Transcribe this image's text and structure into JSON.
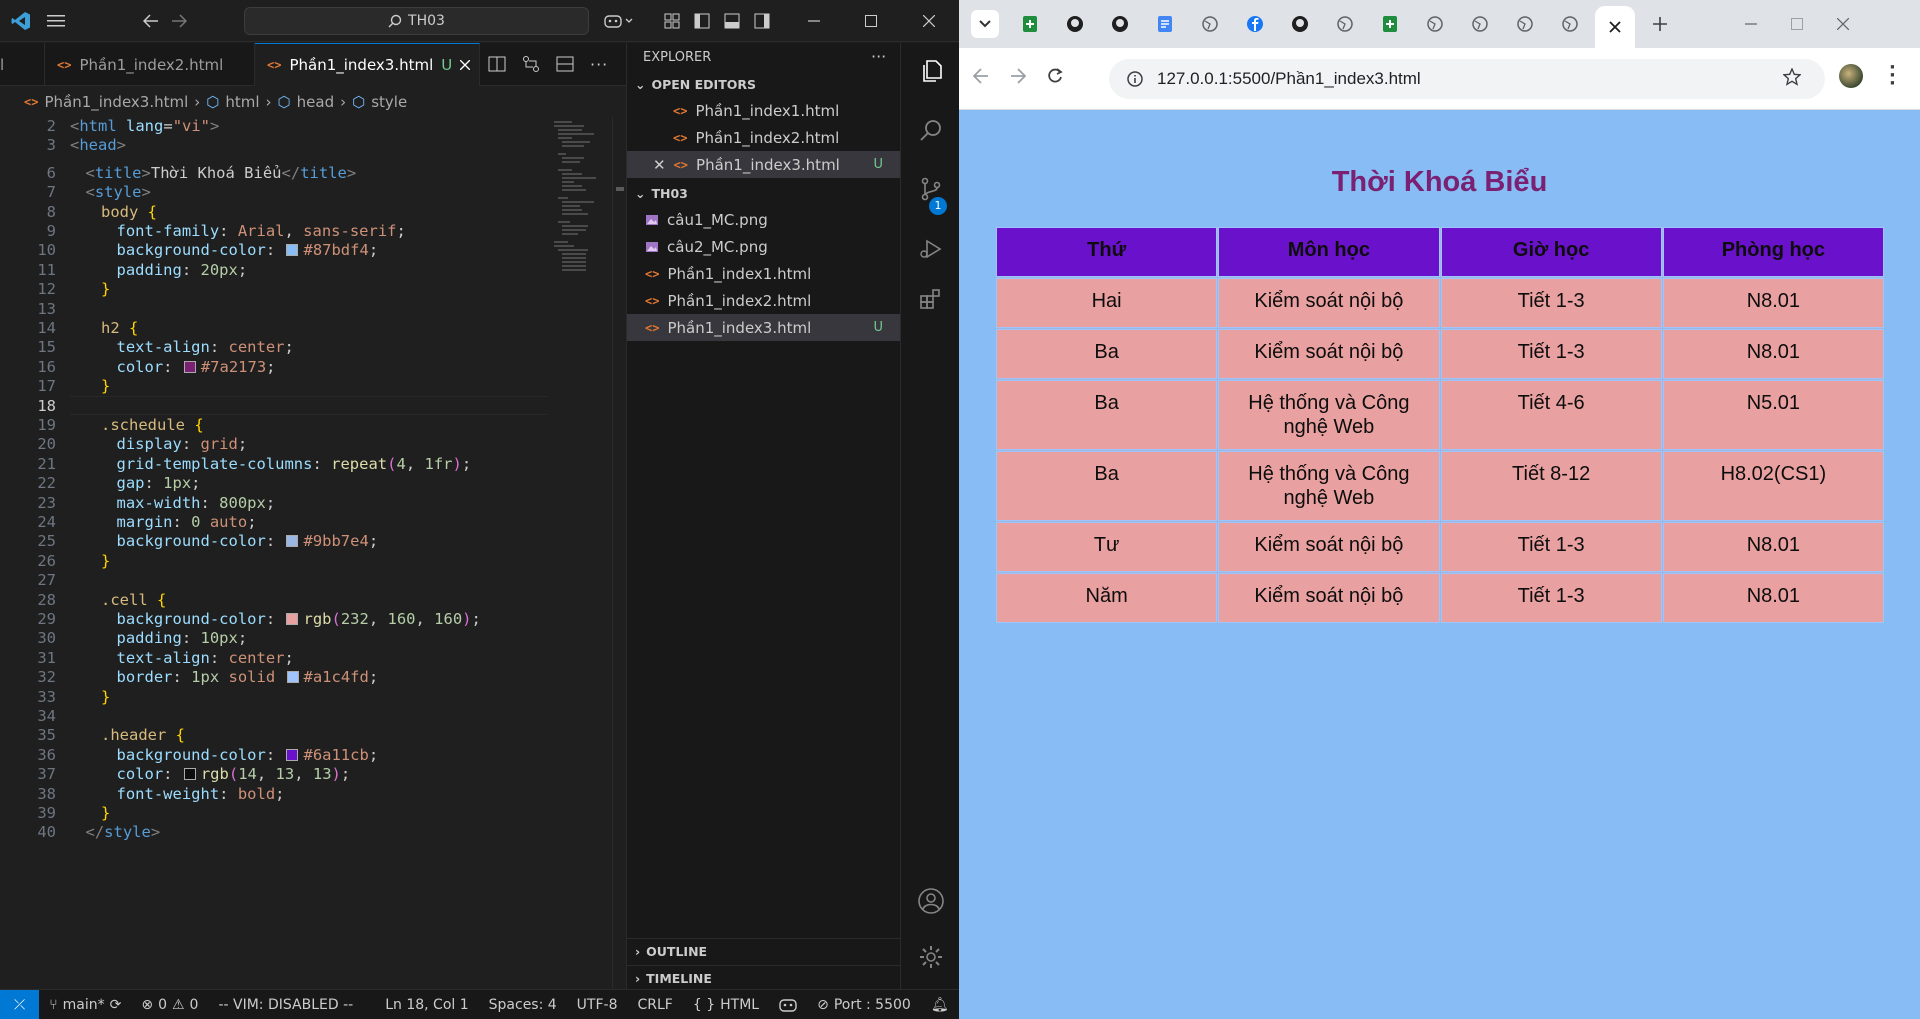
{
  "vscode": {
    "command_center": "TH03",
    "tabs": [
      {
        "label": "Phần1_index2.html",
        "active": false
      },
      {
        "label": "Phần1_index3.html",
        "active": true,
        "modified_flag": "U"
      }
    ],
    "breadcrumb": [
      "Phần1_index3.html",
      "html",
      "head",
      "style"
    ],
    "editor_lines": [
      {
        "n": "2",
        "tokens": [
          {
            "t": "<",
            "c": "#808080"
          },
          {
            "t": "html",
            "c": "#569cd6"
          },
          {
            "t": " lang",
            "c": "#9cdcfe"
          },
          {
            "t": "=",
            "c": "#cccccc"
          },
          {
            "t": "\"vi\"",
            "c": "#ce9178"
          },
          {
            "t": ">",
            "c": "#808080"
          }
        ],
        "indent": 0
      },
      {
        "n": "3",
        "tokens": [
          {
            "t": "<",
            "c": "#808080"
          },
          {
            "t": "head",
            "c": "#569cd6"
          },
          {
            "t": ">",
            "c": "#808080"
          }
        ],
        "indent": 0
      },
      {
        "n": "6",
        "tokens": [
          {
            "t": "<",
            "c": "#808080"
          },
          {
            "t": "title",
            "c": "#569cd6"
          },
          {
            "t": ">",
            "c": "#808080"
          },
          {
            "t": "Thời Khoá Biểu",
            "c": "#cccccc"
          },
          {
            "t": "</",
            "c": "#808080"
          },
          {
            "t": "title",
            "c": "#569cd6"
          },
          {
            "t": ">",
            "c": "#808080"
          }
        ],
        "indent": 1
      },
      {
        "n": "7",
        "tokens": [
          {
            "t": "<",
            "c": "#808080"
          },
          {
            "t": "style",
            "c": "#569cd6"
          },
          {
            "t": ">",
            "c": "#808080"
          }
        ],
        "indent": 1
      },
      {
        "n": "8",
        "tokens": [
          {
            "t": "body",
            "c": "#d7ba7d"
          },
          {
            "t": " {",
            "c": "#ffd700"
          }
        ],
        "indent": 2
      },
      {
        "n": "9",
        "tokens": [
          {
            "t": "font-family",
            "c": "#9cdcfe"
          },
          {
            "t": ": ",
            "c": "#cccccc"
          },
          {
            "t": "Arial",
            "c": "#ce9178"
          },
          {
            "t": ", ",
            "c": "#cccccc"
          },
          {
            "t": "sans-serif",
            "c": "#ce9178"
          },
          {
            "t": ";",
            "c": "#cccccc"
          }
        ],
        "indent": 3
      },
      {
        "n": "10",
        "tokens": [
          {
            "t": "background-color",
            "c": "#9cdcfe"
          },
          {
            "t": ": ",
            "c": "#cccccc"
          },
          {
            "sw": "#87bdf4"
          },
          {
            "t": "#87bdf4",
            "c": "#ce9178"
          },
          {
            "t": ";",
            "c": "#cccccc"
          }
        ],
        "indent": 3
      },
      {
        "n": "11",
        "tokens": [
          {
            "t": "padding",
            "c": "#9cdcfe"
          },
          {
            "t": ": ",
            "c": "#cccccc"
          },
          {
            "t": "20px",
            "c": "#b5cea8"
          },
          {
            "t": ";",
            "c": "#cccccc"
          }
        ],
        "indent": 3
      },
      {
        "n": "12",
        "tokens": [
          {
            "t": "}",
            "c": "#ffd700"
          }
        ],
        "indent": 2
      },
      {
        "n": "13",
        "tokens": [],
        "indent": 0
      },
      {
        "n": "14",
        "tokens": [
          {
            "t": "h2",
            "c": "#d7ba7d"
          },
          {
            "t": " {",
            "c": "#ffd700"
          }
        ],
        "indent": 2
      },
      {
        "n": "15",
        "tokens": [
          {
            "t": "text-align",
            "c": "#9cdcfe"
          },
          {
            "t": ": ",
            "c": "#cccccc"
          },
          {
            "t": "center",
            "c": "#ce9178"
          },
          {
            "t": ";",
            "c": "#cccccc"
          }
        ],
        "indent": 3
      },
      {
        "n": "16",
        "tokens": [
          {
            "t": "color",
            "c": "#9cdcfe"
          },
          {
            "t": ": ",
            "c": "#cccccc"
          },
          {
            "sw": "#7a2173"
          },
          {
            "t": "#7a2173",
            "c": "#ce9178"
          },
          {
            "t": ";",
            "c": "#cccccc"
          }
        ],
        "indent": 3
      },
      {
        "n": "17",
        "tokens": [
          {
            "t": "}",
            "c": "#ffd700"
          }
        ],
        "indent": 2
      },
      {
        "n": "18",
        "tokens": [],
        "indent": 0,
        "current": true
      },
      {
        "n": "19",
        "tokens": [
          {
            "t": ".schedule",
            "c": "#d7ba7d"
          },
          {
            "t": " {",
            "c": "#ffd700"
          }
        ],
        "indent": 2
      },
      {
        "n": "20",
        "tokens": [
          {
            "t": "display",
            "c": "#9cdcfe"
          },
          {
            "t": ": ",
            "c": "#cccccc"
          },
          {
            "t": "grid",
            "c": "#ce9178"
          },
          {
            "t": ";",
            "c": "#cccccc"
          }
        ],
        "indent": 3
      },
      {
        "n": "21",
        "tokens": [
          {
            "t": "grid-template-columns",
            "c": "#9cdcfe"
          },
          {
            "t": ": ",
            "c": "#cccccc"
          },
          {
            "t": "repeat",
            "c": "#dcdcaa"
          },
          {
            "t": "(",
            "c": "#da70d6"
          },
          {
            "t": "4",
            "c": "#b5cea8"
          },
          {
            "t": ", ",
            "c": "#cccccc"
          },
          {
            "t": "1fr",
            "c": "#b5cea8"
          },
          {
            "t": ")",
            "c": "#da70d6"
          },
          {
            "t": ";",
            "c": "#cccccc"
          }
        ],
        "indent": 3
      },
      {
        "n": "22",
        "tokens": [
          {
            "t": "gap",
            "c": "#9cdcfe"
          },
          {
            "t": ": ",
            "c": "#cccccc"
          },
          {
            "t": "1px",
            "c": "#b5cea8"
          },
          {
            "t": ";",
            "c": "#cccccc"
          }
        ],
        "indent": 3
      },
      {
        "n": "23",
        "tokens": [
          {
            "t": "max-width",
            "c": "#9cdcfe"
          },
          {
            "t": ": ",
            "c": "#cccccc"
          },
          {
            "t": "800px",
            "c": "#b5cea8"
          },
          {
            "t": ";",
            "c": "#cccccc"
          }
        ],
        "indent": 3
      },
      {
        "n": "24",
        "tokens": [
          {
            "t": "margin",
            "c": "#9cdcfe"
          },
          {
            "t": ": ",
            "c": "#cccccc"
          },
          {
            "t": "0",
            "c": "#b5cea8"
          },
          {
            "t": " auto",
            "c": "#ce9178"
          },
          {
            "t": ";",
            "c": "#cccccc"
          }
        ],
        "indent": 3
      },
      {
        "n": "25",
        "tokens": [
          {
            "t": "background-color",
            "c": "#9cdcfe"
          },
          {
            "t": ": ",
            "c": "#cccccc"
          },
          {
            "sw": "#9bb7e4"
          },
          {
            "t": "#9bb7e4",
            "c": "#ce9178"
          },
          {
            "t": ";",
            "c": "#cccccc"
          }
        ],
        "indent": 3
      },
      {
        "n": "26",
        "tokens": [
          {
            "t": "}",
            "c": "#ffd700"
          }
        ],
        "indent": 2
      },
      {
        "n": "27",
        "tokens": [],
        "indent": 0
      },
      {
        "n": "28",
        "tokens": [
          {
            "t": ".cell",
            "c": "#d7ba7d"
          },
          {
            "t": " {",
            "c": "#ffd700"
          }
        ],
        "indent": 2
      },
      {
        "n": "29",
        "tokens": [
          {
            "t": "background-color",
            "c": "#9cdcfe"
          },
          {
            "t": ": ",
            "c": "#cccccc"
          },
          {
            "sw": "rgb(232,160,160)"
          },
          {
            "t": "rgb",
            "c": "#dcdcaa"
          },
          {
            "t": "(",
            "c": "#da70d6"
          },
          {
            "t": "232",
            "c": "#b5cea8"
          },
          {
            "t": ", ",
            "c": "#cccccc"
          },
          {
            "t": "160",
            "c": "#b5cea8"
          },
          {
            "t": ", ",
            "c": "#cccccc"
          },
          {
            "t": "160",
            "c": "#b5cea8"
          },
          {
            "t": ")",
            "c": "#da70d6"
          },
          {
            "t": ";",
            "c": "#cccccc"
          }
        ],
        "indent": 3
      },
      {
        "n": "30",
        "tokens": [
          {
            "t": "padding",
            "c": "#9cdcfe"
          },
          {
            "t": ": ",
            "c": "#cccccc"
          },
          {
            "t": "10px",
            "c": "#b5cea8"
          },
          {
            "t": ";",
            "c": "#cccccc"
          }
        ],
        "indent": 3
      },
      {
        "n": "31",
        "tokens": [
          {
            "t": "text-align",
            "c": "#9cdcfe"
          },
          {
            "t": ": ",
            "c": "#cccccc"
          },
          {
            "t": "center",
            "c": "#ce9178"
          },
          {
            "t": ";",
            "c": "#cccccc"
          }
        ],
        "indent": 3
      },
      {
        "n": "32",
        "tokens": [
          {
            "t": "border",
            "c": "#9cdcfe"
          },
          {
            "t": ": ",
            "c": "#cccccc"
          },
          {
            "t": "1px",
            "c": "#b5cea8"
          },
          {
            "t": " solid ",
            "c": "#ce9178"
          },
          {
            "sw": "#a1c4fd"
          },
          {
            "t": "#a1c4fd",
            "c": "#ce9178"
          },
          {
            "t": ";",
            "c": "#cccccc"
          }
        ],
        "indent": 3
      },
      {
        "n": "33",
        "tokens": [
          {
            "t": "}",
            "c": "#ffd700"
          }
        ],
        "indent": 2
      },
      {
        "n": "34",
        "tokens": [],
        "indent": 0
      },
      {
        "n": "35",
        "tokens": [
          {
            "t": ".header",
            "c": "#d7ba7d"
          },
          {
            "t": " {",
            "c": "#ffd700"
          }
        ],
        "indent": 2
      },
      {
        "n": "36",
        "tokens": [
          {
            "t": "background-color",
            "c": "#9cdcfe"
          },
          {
            "t": ": ",
            "c": "#cccccc"
          },
          {
            "sw": "#6a11cb"
          },
          {
            "t": "#6a11cb",
            "c": "#ce9178"
          },
          {
            "t": ";",
            "c": "#cccccc"
          }
        ],
        "indent": 3
      },
      {
        "n": "37",
        "tokens": [
          {
            "t": "color",
            "c": "#9cdcfe"
          },
          {
            "t": ": ",
            "c": "#cccccc"
          },
          {
            "sw": "rgb(14,13,13)"
          },
          {
            "t": "rgb",
            "c": "#dcdcaa"
          },
          {
            "t": "(",
            "c": "#da70d6"
          },
          {
            "t": "14",
            "c": "#b5cea8"
          },
          {
            "t": ", ",
            "c": "#cccccc"
          },
          {
            "t": "13",
            "c": "#b5cea8"
          },
          {
            "t": ", ",
            "c": "#cccccc"
          },
          {
            "t": "13",
            "c": "#b5cea8"
          },
          {
            "t": ")",
            "c": "#da70d6"
          },
          {
            "t": ";",
            "c": "#cccccc"
          }
        ],
        "indent": 3
      },
      {
        "n": "38",
        "tokens": [
          {
            "t": "font-weight",
            "c": "#9cdcfe"
          },
          {
            "t": ": ",
            "c": "#cccccc"
          },
          {
            "t": "bold",
            "c": "#ce9178"
          },
          {
            "t": ";",
            "c": "#cccccc"
          }
        ],
        "indent": 3
      },
      {
        "n": "39",
        "tokens": [
          {
            "t": "}",
            "c": "#ffd700"
          }
        ],
        "indent": 2
      },
      {
        "n": "40",
        "tokens": [
          {
            "t": "</",
            "c": "#808080"
          },
          {
            "t": "style",
            "c": "#569cd6"
          },
          {
            "t": ">",
            "c": "#808080"
          }
        ],
        "indent": 1
      }
    ],
    "explorer": {
      "title": "EXPLORER",
      "open_editors_label": "OPEN EDITORS",
      "open_editors": [
        "Phần1_index1.html",
        "Phần1_index2.html",
        "Phần1_index3.html"
      ],
      "folder_label": "TH03",
      "files": [
        {
          "name": "câu1_MC.png",
          "kind": "image"
        },
        {
          "name": "câu2_MC.png",
          "kind": "image"
        },
        {
          "name": "Phần1_index1.html",
          "kind": "html"
        },
        {
          "name": "Phần1_index2.html",
          "kind": "html"
        },
        {
          "name": "Phần1_index3.html",
          "kind": "html",
          "badge": "U"
        }
      ],
      "outline_label": "OUTLINE",
      "timeline_label": "TIMELINE",
      "source_control_badge": "1"
    },
    "statusbar": {
      "branch": "main*",
      "errors": "0",
      "warnings": "0",
      "vim": "-- VIM: DISABLED --",
      "position": "Ln 18, Col 1",
      "spaces": "Spaces: 4",
      "encoding": "UTF-8",
      "eol": "CRLF",
      "language": "HTML",
      "port": "Port : 5500"
    }
  },
  "browser": {
    "url": "127.0.0.1:5500/Phần1_index3.html",
    "page": {
      "title": "Thời Khoá Biểu",
      "headers": [
        "Thứ",
        "Môn học",
        "Giờ học",
        "Phòng học"
      ],
      "rows": [
        [
          "Hai",
          "Kiểm soát nội bộ",
          "Tiết 1-3",
          "N8.01"
        ],
        [
          "Ba",
          "Kiểm soát nội bộ",
          "Tiết 1-3",
          "N8.01"
        ],
        [
          "Ba",
          "Hệ thống và Công nghệ Web",
          "Tiết 4-6",
          "N5.01"
        ],
        [
          "Ba",
          "Hệ thống và Công nghệ Web",
          "Tiết 8-12",
          "H8.02(CS1)"
        ],
        [
          "Tư",
          "Kiểm soát nội bộ",
          "Tiết 1-3",
          "N8.01"
        ],
        [
          "Năm",
          "Kiểm soát nội bộ",
          "Tiết 1-3",
          "N8.01"
        ]
      ]
    }
  }
}
